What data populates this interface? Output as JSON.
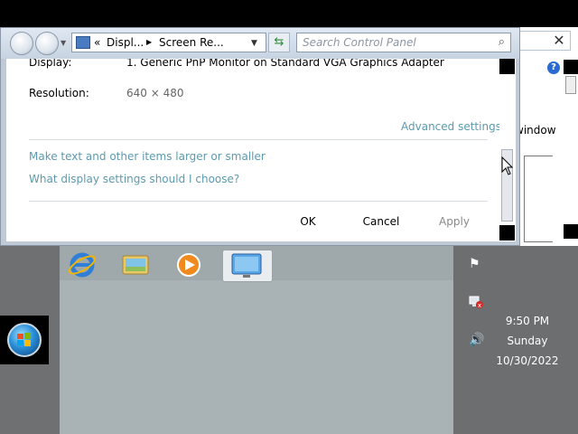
{
  "window": {
    "address": {
      "prefix": "«",
      "seg1": "Displ...",
      "seg2": "Screen Re..."
    },
    "search_placeholder": "Search Control Panel",
    "content": {
      "display_label": "Display:",
      "display_value": "1. Generic PnP Monitor on Standard VGA Graphics Adapter",
      "resolution_label": "Resolution:",
      "resolution_value": "640 × 480",
      "advanced_link": "Advanced settings",
      "links": [
        "Make text and other items larger or smaller",
        "What display settings should I choose?"
      ],
      "ok": "OK",
      "cancel": "Cancel",
      "apply": "Apply"
    }
  },
  "background_window": {
    "text": "window",
    "close_glyph": "✕",
    "help_glyph": "?"
  },
  "taskbar": {
    "icons": [
      "internet-explorer-icon",
      "windows-explorer-icon",
      "media-player-icon",
      "display-settings-icon"
    ]
  },
  "tray": {
    "time": "9:50 PM",
    "day": "Sunday",
    "date": "10/30/2022"
  },
  "colors": {
    "link": "#5b9aaf",
    "desktop": "#a9b3b5",
    "tray": "#6d6e70"
  }
}
